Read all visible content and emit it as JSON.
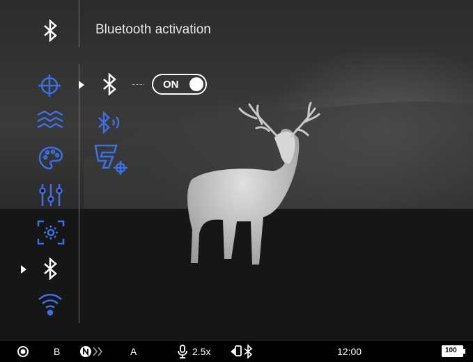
{
  "menu": {
    "title": "Bluetooth activation",
    "toggle_label": "ON",
    "header_icon": "bluetooth-icon",
    "sidebar_icons": [
      "crosshair-icon",
      "waves-icon",
      "palette-icon",
      "sliders-icon",
      "brightness-icon",
      "bluetooth-icon",
      "wifi-settings-icon"
    ],
    "submenu_icons": [
      "bluetooth-icon",
      "bluetooth-sound-icon",
      "stream-vision-icon"
    ]
  },
  "statusbar": {
    "mode": "B",
    "slot": "A",
    "zoom": "2.5x",
    "time": "12:00",
    "battery": "100"
  },
  "colors": {
    "accent": "#3d6fe6",
    "text": "#ffffff"
  }
}
